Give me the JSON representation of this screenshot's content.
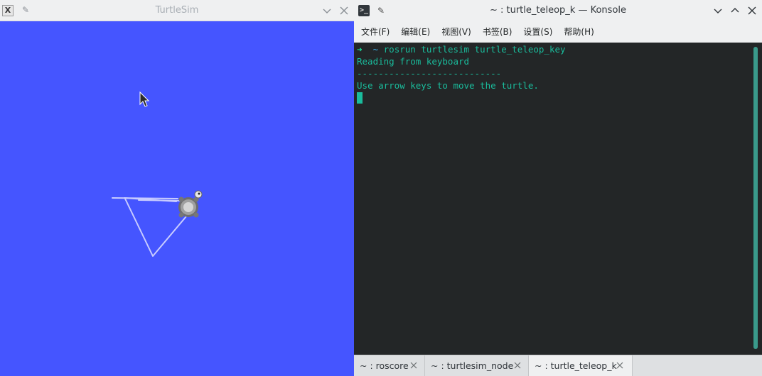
{
  "turtlesim": {
    "title": "TurtleSim",
    "app_icon": "X",
    "pin_glyph": "✎",
    "background_color": "#4555ff",
    "trail_color": "#c8ccff"
  },
  "konsole": {
    "title": "~ : turtle_teleop_k — Konsole",
    "app_icon": ">_",
    "pin_glyph": "✎",
    "menu": [
      "文件(F)",
      "编辑(E)",
      "视图(V)",
      "书签(B)",
      "设置(S)",
      "帮助(H)"
    ],
    "terminal": {
      "prompt_arrow": "➜",
      "prompt_dir": "~",
      "command": "rosrun turtlesim turtle_teleop_key",
      "lines": [
        "Reading from keyboard",
        "---------------------------",
        "Use arrow keys to move the turtle."
      ]
    },
    "tabs": [
      {
        "label": "~ : roscore",
        "active": false
      },
      {
        "label": "~ : turtlesim_node",
        "active": false
      },
      {
        "label": "~ : turtle_teleop_k",
        "active": true
      }
    ],
    "accent_color": "#1abc9c",
    "terminal_bg": "#232627"
  }
}
